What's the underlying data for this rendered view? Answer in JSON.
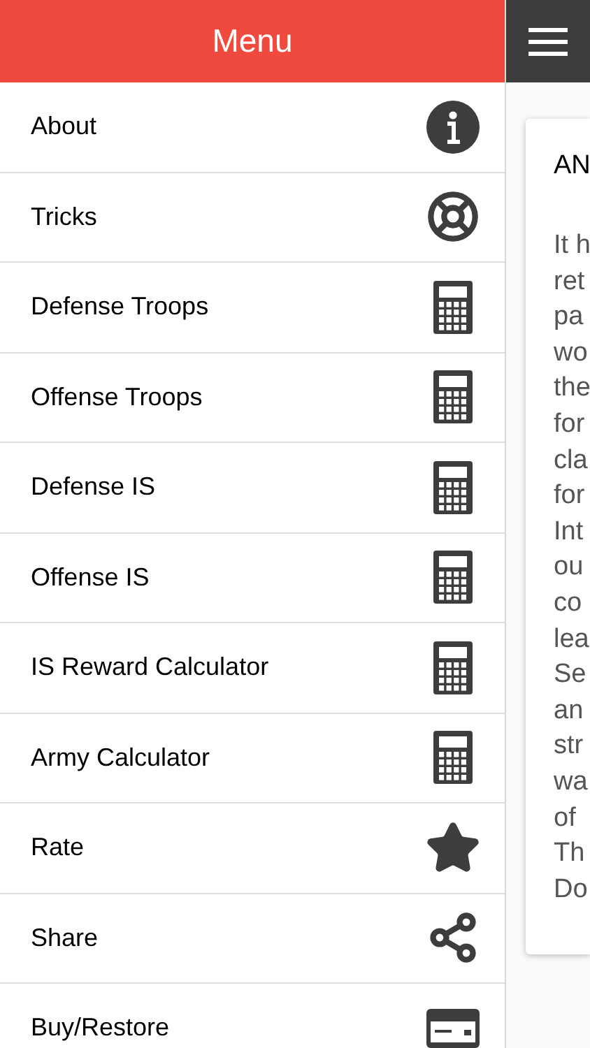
{
  "menu": {
    "title": "Menu",
    "items": [
      {
        "label": "About",
        "kind": "info"
      },
      {
        "label": "Tricks",
        "kind": "lifebuoy"
      },
      {
        "label": "Defense Troops",
        "kind": "calculator"
      },
      {
        "label": "Offense Troops",
        "kind": "calculator"
      },
      {
        "label": "Defense IS",
        "kind": "calculator"
      },
      {
        "label": "Offense IS",
        "kind": "calculator"
      },
      {
        "label": "IS Reward Calculator",
        "kind": "calculator"
      },
      {
        "label": "Army Calculator",
        "kind": "calculator"
      },
      {
        "label": "Rate",
        "kind": "star"
      },
      {
        "label": "Share",
        "kind": "share"
      },
      {
        "label": "Buy/Restore",
        "kind": "card"
      }
    ]
  },
  "content": {
    "heading": "AN",
    "lines": [
      "It h",
      "ret",
      "pa",
      "wo",
      "the",
      "for",
      "cla",
      "for",
      "Int",
      "ou",
      "co",
      "lea",
      "Se",
      "an",
      "str",
      "wa",
      "of",
      "Th",
      "Do"
    ]
  }
}
